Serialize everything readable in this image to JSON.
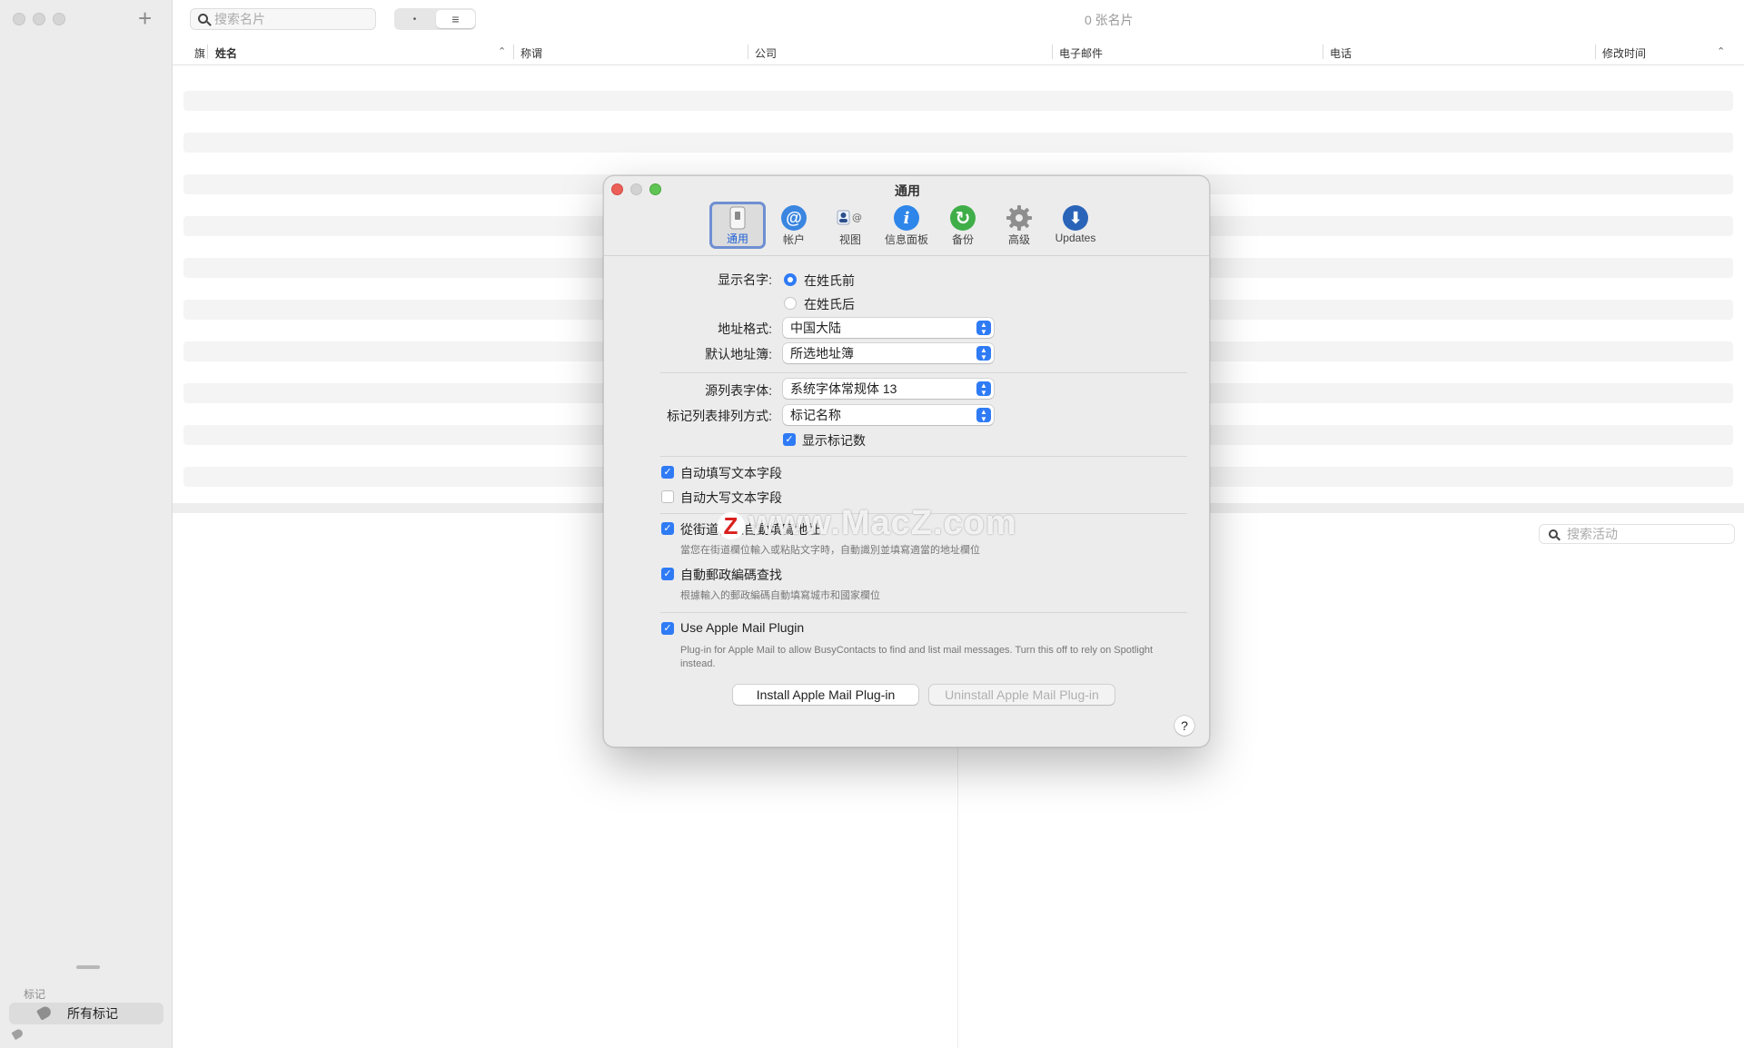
{
  "toolbar": {
    "search_placeholder": "搜索名片",
    "card_count": "0 张名片",
    "view_seg_1": "•",
    "view_seg_2": "≡"
  },
  "table": {
    "columns": [
      "旗",
      "姓名",
      "称谓",
      "公司",
      "电子邮件",
      "电话",
      "修改时间"
    ]
  },
  "sidebar": {
    "section_label": "标记",
    "all_tags": "所有标记"
  },
  "activity_search_placeholder": "搜索活动",
  "dialog": {
    "title": "通用",
    "tabs": [
      {
        "label": "通用",
        "icon": "phone-icon",
        "selected": true
      },
      {
        "label": "帐户",
        "icon": "at-sign-icon"
      },
      {
        "label": "视图",
        "icon": "view-icon"
      },
      {
        "label": "信息面板",
        "icon": "info-icon"
      },
      {
        "label": "备份",
        "icon": "backup-icon"
      },
      {
        "label": "高级",
        "icon": "gear-icon"
      },
      {
        "label": "Updates",
        "icon": "download-icon"
      }
    ],
    "display_name_label": "显示名字:",
    "radio_first": "在姓氏前",
    "radio_last": "在姓氏后",
    "address_format_label": "地址格式:",
    "address_format_value": "中国大陆",
    "default_book_label": "默认地址簿:",
    "default_book_value": "所选地址簿",
    "source_font_label": "源列表字体:",
    "source_font_value": "系统字体常规体 13",
    "tag_sort_label": "标记列表排列方式:",
    "tag_sort_value": "标记名称",
    "show_tag_count": "显示标记数",
    "autofill_text": "自动填写文本字段",
    "autocap_text": "自动大写文本字段",
    "street_autofill": "從街道欄位自動填寫地址",
    "street_autofill_note": "當您在街道欄位輸入或粘貼文字時，自動識別並填寫適當的地址欄位",
    "postal_lookup": "自動郵政編碼查找",
    "postal_lookup_note": "根據輸入的郵政編碼自動填寫城市和國家欄位",
    "mail_plugin": "Use Apple Mail Plugin",
    "mail_plugin_note": "Plug-in for Apple Mail to allow BusyContacts to find and list mail messages. Turn this off to rely on Spotlight instead.",
    "install_btn": "Install Apple Mail Plug-in",
    "uninstall_btn": "Uninstall Apple Mail Plug-in",
    "help": "?"
  },
  "watermark": {
    "badge": "Z",
    "text": "www.MacZ.com"
  },
  "colors": {
    "accent": "#2f7bf6",
    "close": "#ec5f57",
    "minimize": "#d0d0d0",
    "zoom": "#5fc454"
  }
}
